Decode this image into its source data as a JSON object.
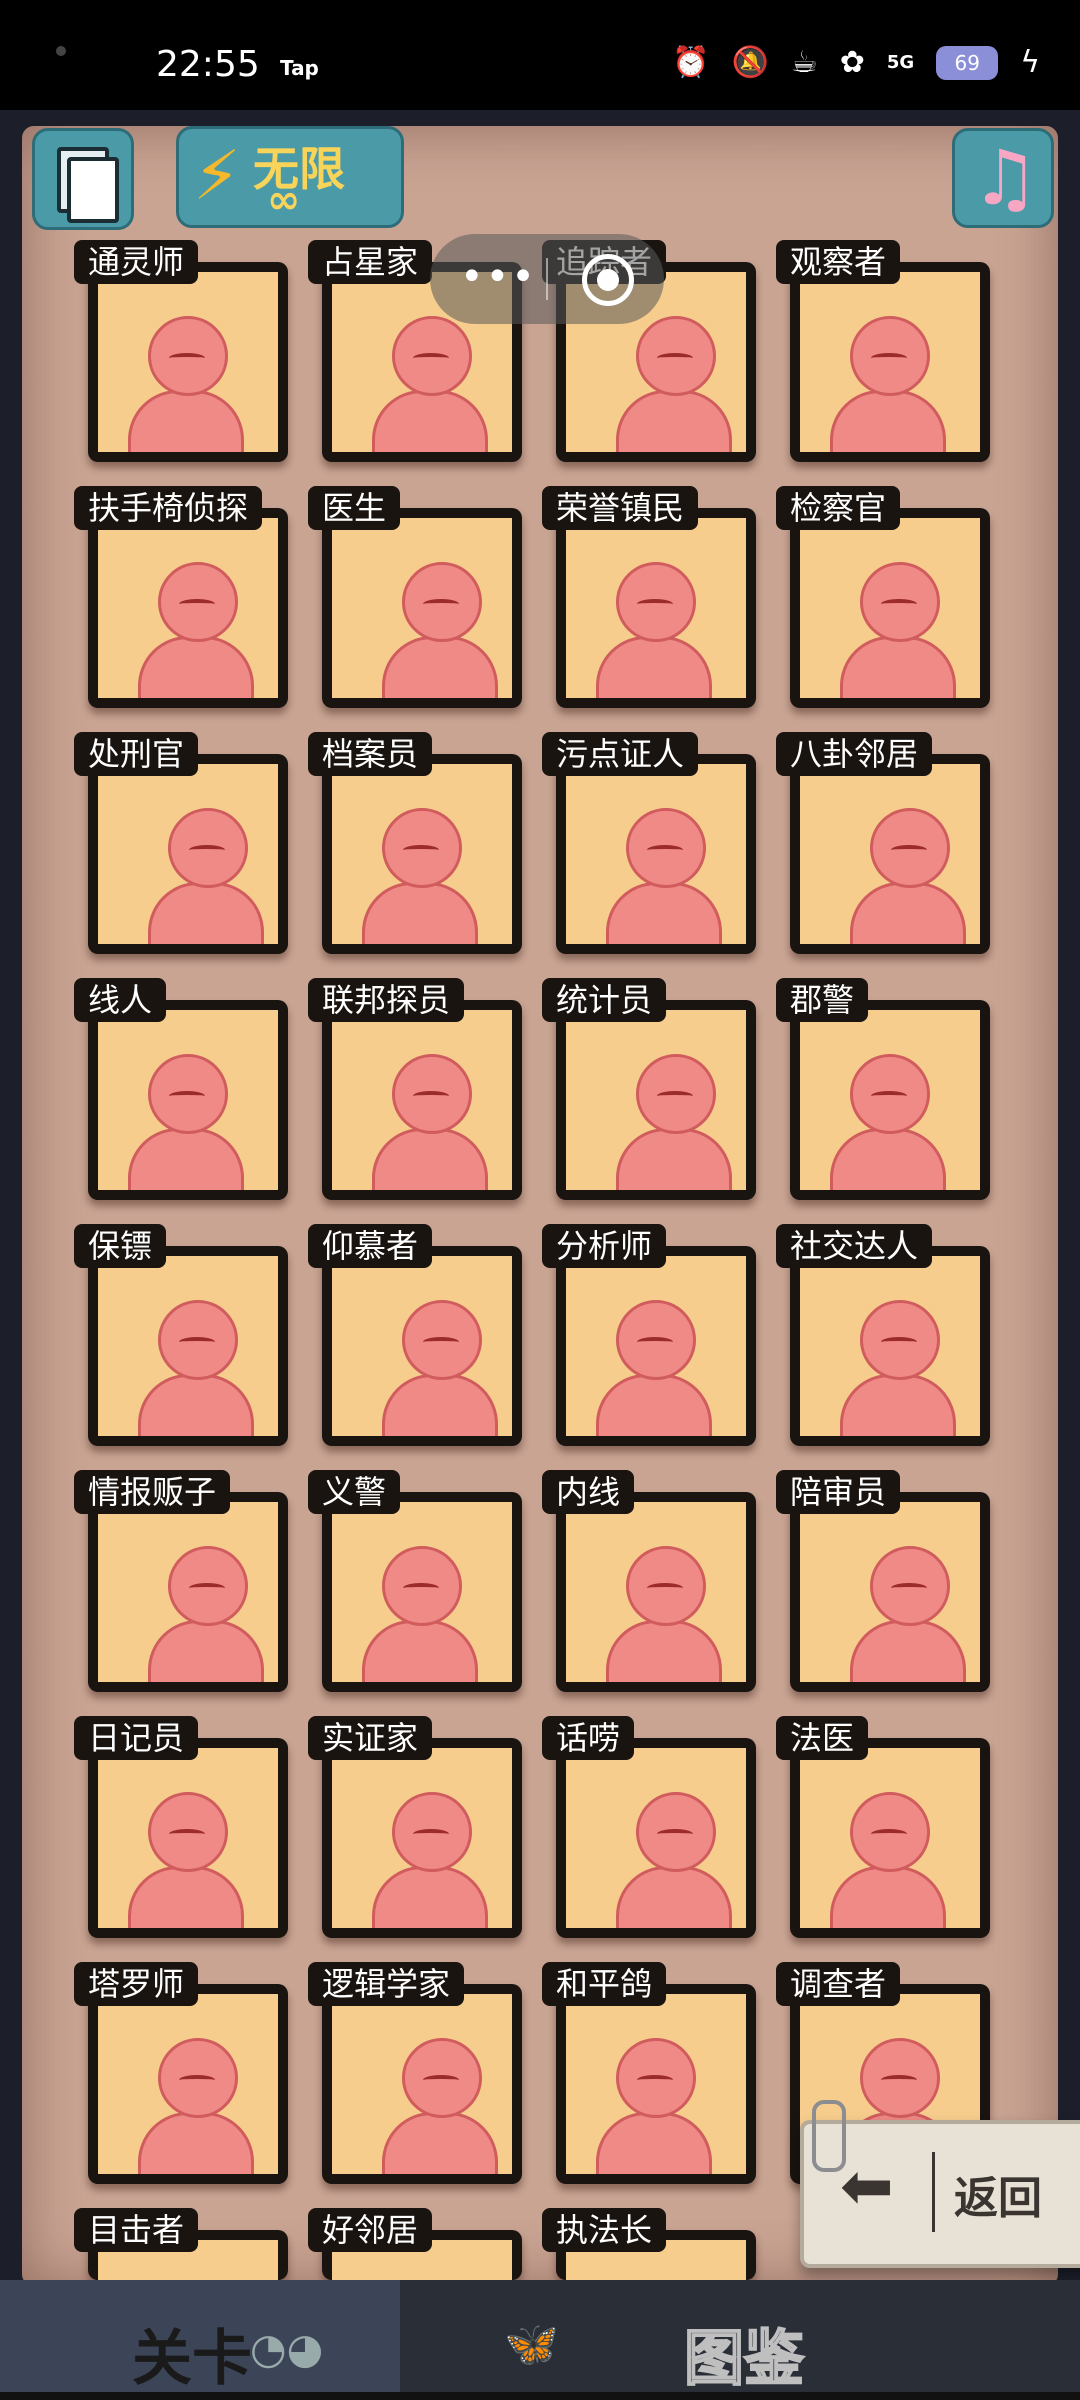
{
  "status_bar": {
    "time": "22:55",
    "app_label": "Tap",
    "network": "5G",
    "battery": "69",
    "icons": [
      "alarm-icon",
      "mute-icon",
      "wifi-icon",
      "hd-icon",
      "signal-icon",
      "battery-icon",
      "charging-icon"
    ]
  },
  "top_bar": {
    "energy_label": "无限",
    "energy_sub": "∞",
    "doc_icon": "documents-icon",
    "music_icon": "music-note-icon"
  },
  "cards": [
    {
      "label": "通灵师"
    },
    {
      "label": "占星家"
    },
    {
      "label": "追踪者"
    },
    {
      "label": "观察者"
    },
    {
      "label": "扶手椅侦探"
    },
    {
      "label": "医生"
    },
    {
      "label": "荣誉镇民"
    },
    {
      "label": "检察官"
    },
    {
      "label": "处刑官"
    },
    {
      "label": "档案员"
    },
    {
      "label": "污点证人"
    },
    {
      "label": "八卦邻居"
    },
    {
      "label": "线人"
    },
    {
      "label": "联邦探员"
    },
    {
      "label": "统计员"
    },
    {
      "label": "郡警"
    },
    {
      "label": "保镖"
    },
    {
      "label": "仰慕者"
    },
    {
      "label": "分析师"
    },
    {
      "label": "社交达人"
    },
    {
      "label": "情报贩子"
    },
    {
      "label": "义警"
    },
    {
      "label": "内线"
    },
    {
      "label": "陪审员"
    },
    {
      "label": "日记员"
    },
    {
      "label": "实证家"
    },
    {
      "label": "话唠"
    },
    {
      "label": "法医"
    },
    {
      "label": "塔罗师"
    },
    {
      "label": "逻辑学家"
    },
    {
      "label": "和平鸽"
    },
    {
      "label": "调查者"
    },
    {
      "label": "目击者"
    },
    {
      "label": "好邻居"
    },
    {
      "label": "执法长"
    }
  ],
  "back_button": {
    "label": "返回"
  },
  "bottom_nav": {
    "levels_label": "关卡",
    "gallery_label": "图鉴"
  },
  "colors": {
    "paper": "#c9a493",
    "card_bg": "#f6cd8d",
    "card_border": "#1a1410",
    "accent": "#4a9aa8"
  }
}
